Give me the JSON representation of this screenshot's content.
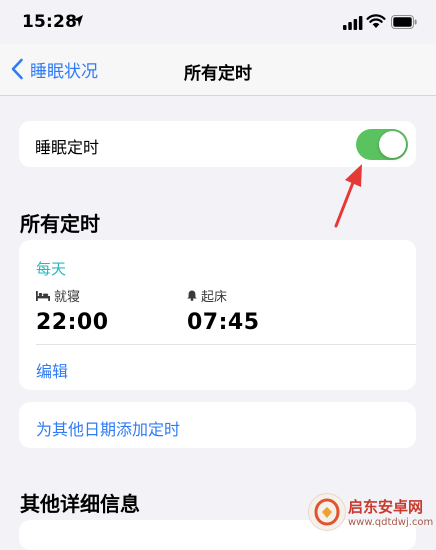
{
  "status_bar": {
    "time": "15:28"
  },
  "nav": {
    "back_label": "睡眠状况",
    "title": "所有定时"
  },
  "sleep_schedule": {
    "label": "睡眠定时",
    "enabled": true
  },
  "all_schedules": {
    "section_title": "所有定时",
    "schedule": {
      "days": "每天",
      "bedtime_label": "就寝",
      "bedtime": "22:00",
      "wake_label": "起床",
      "wake_time": "07:45",
      "edit_label": "编辑"
    },
    "add_label": "为其他日期添加定时"
  },
  "other_details": {
    "section_title": "其他详细信息"
  },
  "watermark": {
    "name": "启东安卓网",
    "url": "www.qdtdwj.com"
  },
  "colors": {
    "accent": "#2f7cf6",
    "toggle_on": "#5ac25f",
    "day_label": "#28b8c0",
    "annotation": "#e53935"
  }
}
